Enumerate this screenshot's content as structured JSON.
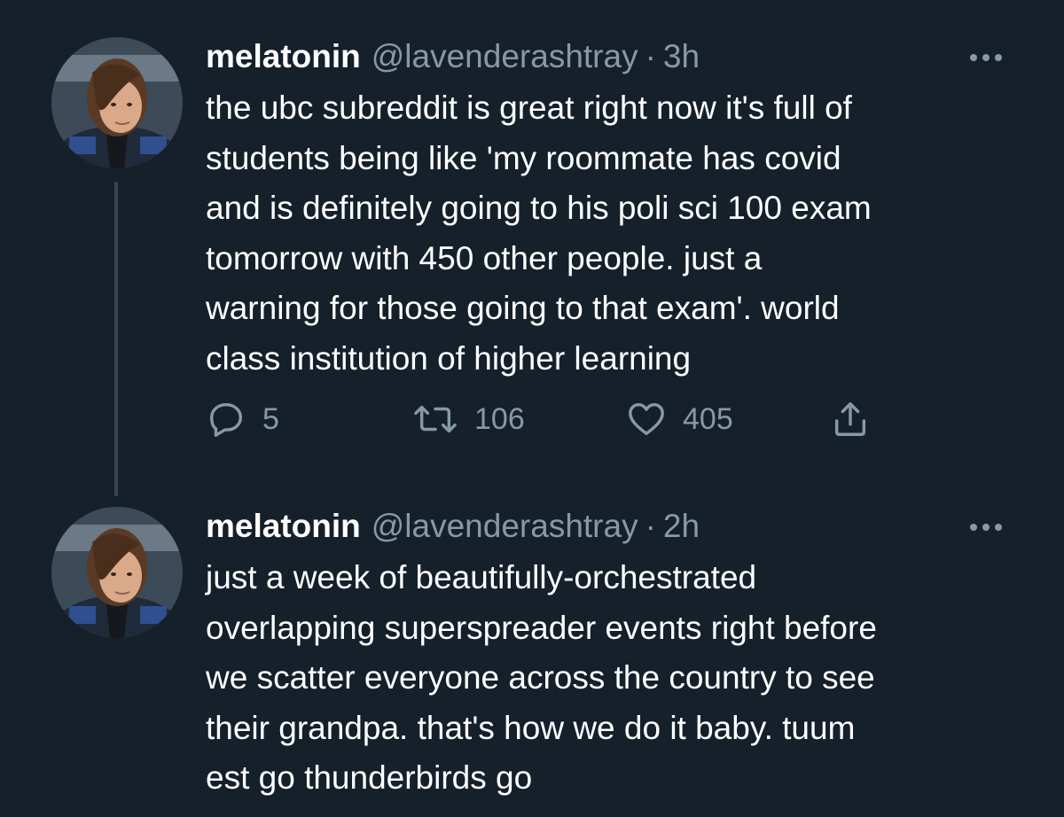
{
  "tweets": [
    {
      "display_name": "melatonin",
      "handle": "@lavenderashtray",
      "separator": "·",
      "time": "3h",
      "text": "the ubc subreddit is great right now it's full of\nstudents being like 'my roommate has covid\nand is definitely going to his poli sci 100 exam\ntomorrow with 450 other people. just a\nwarning for those going to that exam'. world\nclass institution of higher learning",
      "replies": "5",
      "retweets": "106",
      "likes": "405"
    },
    {
      "display_name": "melatonin",
      "handle": "@lavenderashtray",
      "separator": "·",
      "time": "2h",
      "text": "just a week of beautifully-orchestrated\noverlapping superspreader events right before\nwe scatter everyone across the country to see\ntheir grandpa. that's how we do it baby. tuum\nest go thunderbirds go"
    }
  ],
  "colors": {
    "background": "#15202b",
    "text_primary": "#ffffff",
    "text_secondary": "#8899a6",
    "thread_line": "#38444d"
  },
  "icons": {
    "reply": "reply-icon",
    "retweet": "retweet-icon",
    "like": "heart-icon",
    "share": "share-icon",
    "more": "more-options-icon"
  }
}
